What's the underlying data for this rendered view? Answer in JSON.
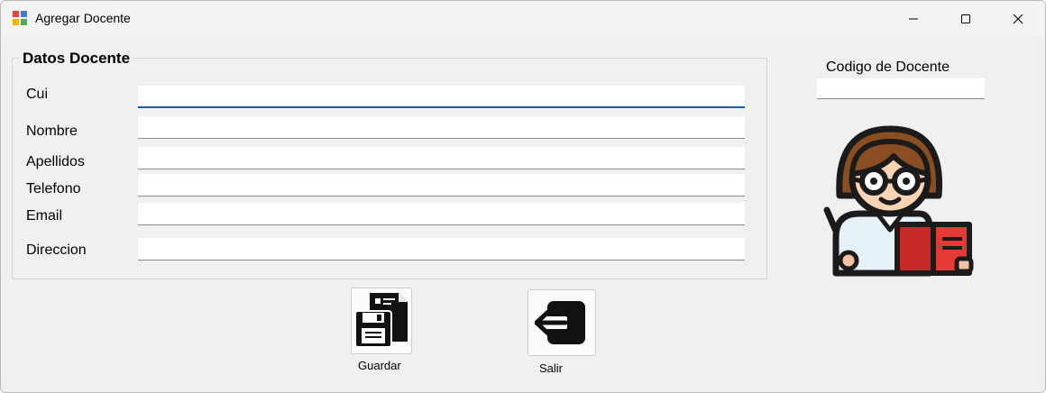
{
  "window": {
    "title": "Agregar Docente",
    "icon": "app-form-icon",
    "controls": {
      "minimize": "minimize-icon",
      "maximize": "maximize-icon",
      "close": "close-icon"
    }
  },
  "group": {
    "title": "Datos Docente",
    "fields": [
      {
        "key": "cui",
        "label": "Cui",
        "value": "",
        "focused": true
      },
      {
        "key": "nombre",
        "label": "Nombre",
        "value": ""
      },
      {
        "key": "apellidos",
        "label": "Apellidos",
        "value": ""
      },
      {
        "key": "telefono",
        "label": "Telefono",
        "value": ""
      },
      {
        "key": "email",
        "label": "Email",
        "value": ""
      },
      {
        "key": "direccion",
        "label": "Direccion",
        "value": ""
      }
    ]
  },
  "codigo": {
    "label": "Codigo de Docente",
    "value": ""
  },
  "illustration": {
    "icon": "teacher-avatar-icon"
  },
  "buttons": {
    "guardar": {
      "label": "Guardar",
      "icon": "floppy-save-icon"
    },
    "salir": {
      "label": "Salir",
      "icon": "exit-door-icon"
    }
  },
  "colors": {
    "accent": "#005fb8",
    "window_bg": "#f0f0f0",
    "book_red": "#e53935"
  }
}
